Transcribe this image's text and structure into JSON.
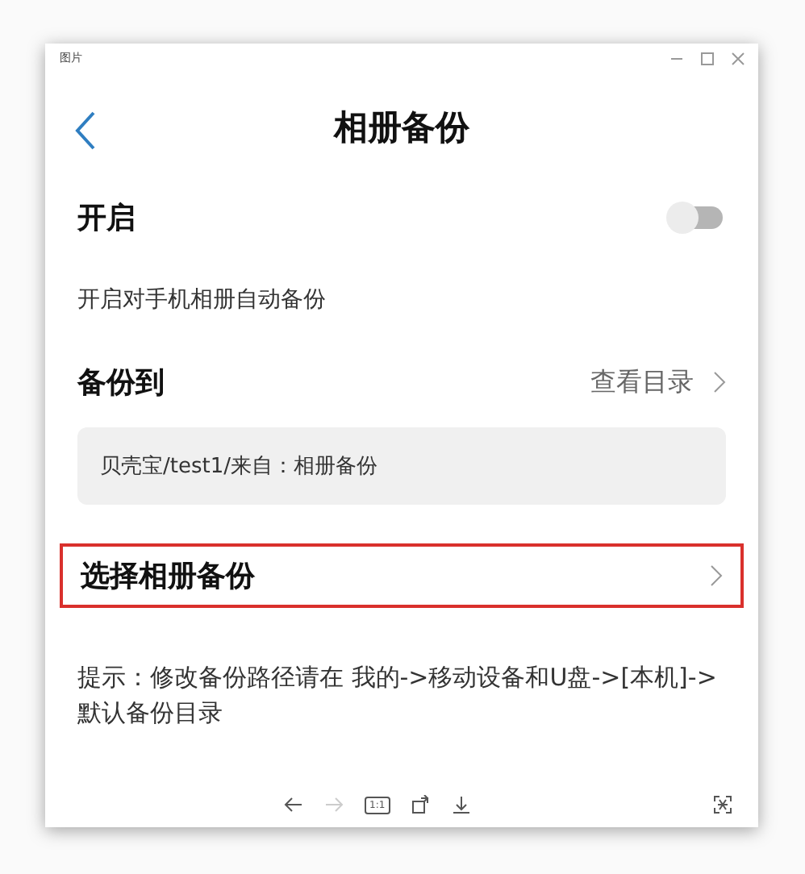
{
  "window": {
    "title": "图片"
  },
  "header": {
    "title": "相册备份"
  },
  "enable": {
    "label": "开启",
    "on": false,
    "description": "开启对手机相册自动备份"
  },
  "backup_to": {
    "label": "备份到",
    "link": "查看目录",
    "path": "贝壳宝/test1/来自：相册备份"
  },
  "select_row": {
    "label": "选择相册备份",
    "highlighted": true
  },
  "hint": "提示：修改备份路径请在 我的->移动设备和U盘->[本机]->默认备份目录",
  "viewer_toolbar": {
    "zoom_label": "1:1",
    "forward_disabled": true
  }
}
